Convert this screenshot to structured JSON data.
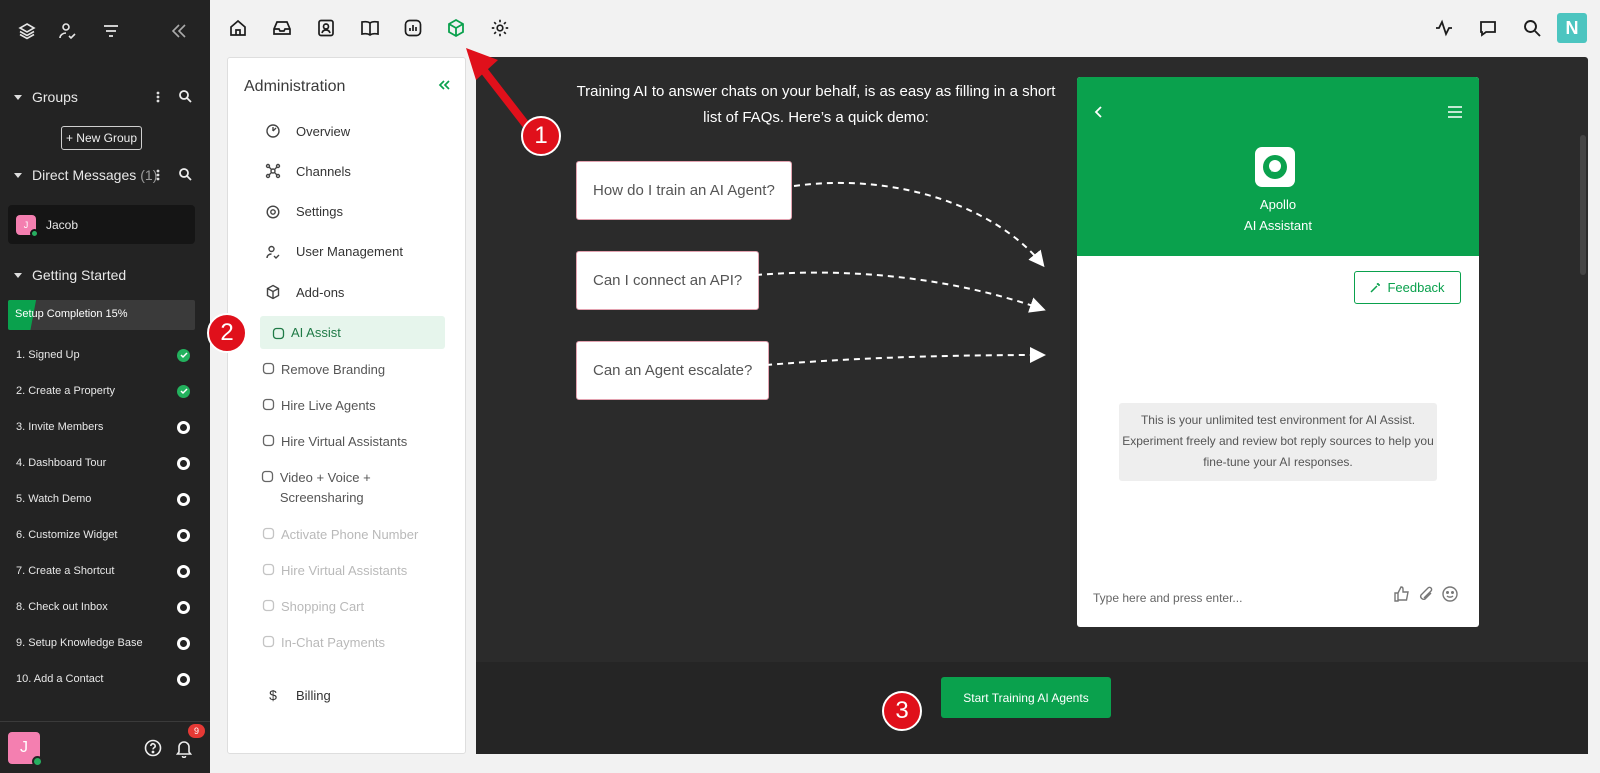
{
  "sidebar": {
    "groups": {
      "label": "Groups",
      "new_group": "+ New Group"
    },
    "dms": {
      "label": "Direct Messages",
      "count": "(1)",
      "contacts": [
        {
          "initial": "J",
          "name": "Jacob"
        }
      ]
    },
    "getting_started": {
      "label": "Getting Started",
      "completion": "Setup Completion 15%",
      "progress": 0.15,
      "steps": [
        {
          "label": "1. Signed Up",
          "done": true
        },
        {
          "label": "2. Create a Property",
          "done": true
        },
        {
          "label": "3. Invite Members",
          "done": false
        },
        {
          "label": "4. Dashboard Tour",
          "done": false
        },
        {
          "label": "5. Watch Demo",
          "done": false
        },
        {
          "label": "6. Customize Widget",
          "done": false
        },
        {
          "label": "7. Create a Shortcut",
          "done": false
        },
        {
          "label": "8. Check out Inbox",
          "done": false
        },
        {
          "label": "9. Setup Knowledge Base",
          "done": false
        },
        {
          "label": "10. Add a Contact",
          "done": false
        }
      ]
    },
    "user_initial": "J",
    "notifications": "9"
  },
  "topbar": {
    "user_initial": "N"
  },
  "admin": {
    "title": "Administration",
    "items": [
      {
        "label": "Overview",
        "icon": "overview-icon"
      },
      {
        "label": "Channels",
        "icon": "channels-icon"
      },
      {
        "label": "Settings",
        "icon": "settings-icon"
      },
      {
        "label": "User Management",
        "icon": "user-management-icon"
      },
      {
        "label": "Add-ons",
        "icon": "addons-icon"
      }
    ],
    "addons": [
      {
        "label": "AI Assist",
        "state": "active"
      },
      {
        "label": "Remove Branding",
        "state": "normal"
      },
      {
        "label": "Hire Live Agents",
        "state": "normal"
      },
      {
        "label": "Hire Virtual Assistants",
        "state": "normal"
      },
      {
        "label": "Video + Voice + Screensharing",
        "state": "normal"
      },
      {
        "label": "Activate Phone Number",
        "state": "dim"
      },
      {
        "label": "Hire Virtual Assistants",
        "state": "dim"
      },
      {
        "label": "Shopping Cart",
        "state": "dim"
      },
      {
        "label": "In-Chat Payments",
        "state": "dim"
      }
    ],
    "billing": "Billing"
  },
  "main": {
    "intro": "Training AI to answer chats on your behalf, is as easy as filling in a short list of FAQs. Here’s a quick demo:",
    "faqs": [
      "How do I train an AI Agent?",
      "Can I connect an API?",
      "Can an Agent escalate?"
    ],
    "widget": {
      "name": "Apollo",
      "subtitle": "AI Assistant",
      "feedback": "Feedback",
      "note": "This is your unlimited test environment for AI Assist. Experiment freely and review bot reply sources to help you fine-tune your AI responses.",
      "input_placeholder": "Type here and press enter..."
    },
    "start_button": "Start Training AI Agents"
  },
  "callouts": [
    "1",
    "2",
    "3"
  ],
  "colors": {
    "brand": "#0aa14d",
    "callout": "#e0101b",
    "sidebar": "#232323"
  }
}
